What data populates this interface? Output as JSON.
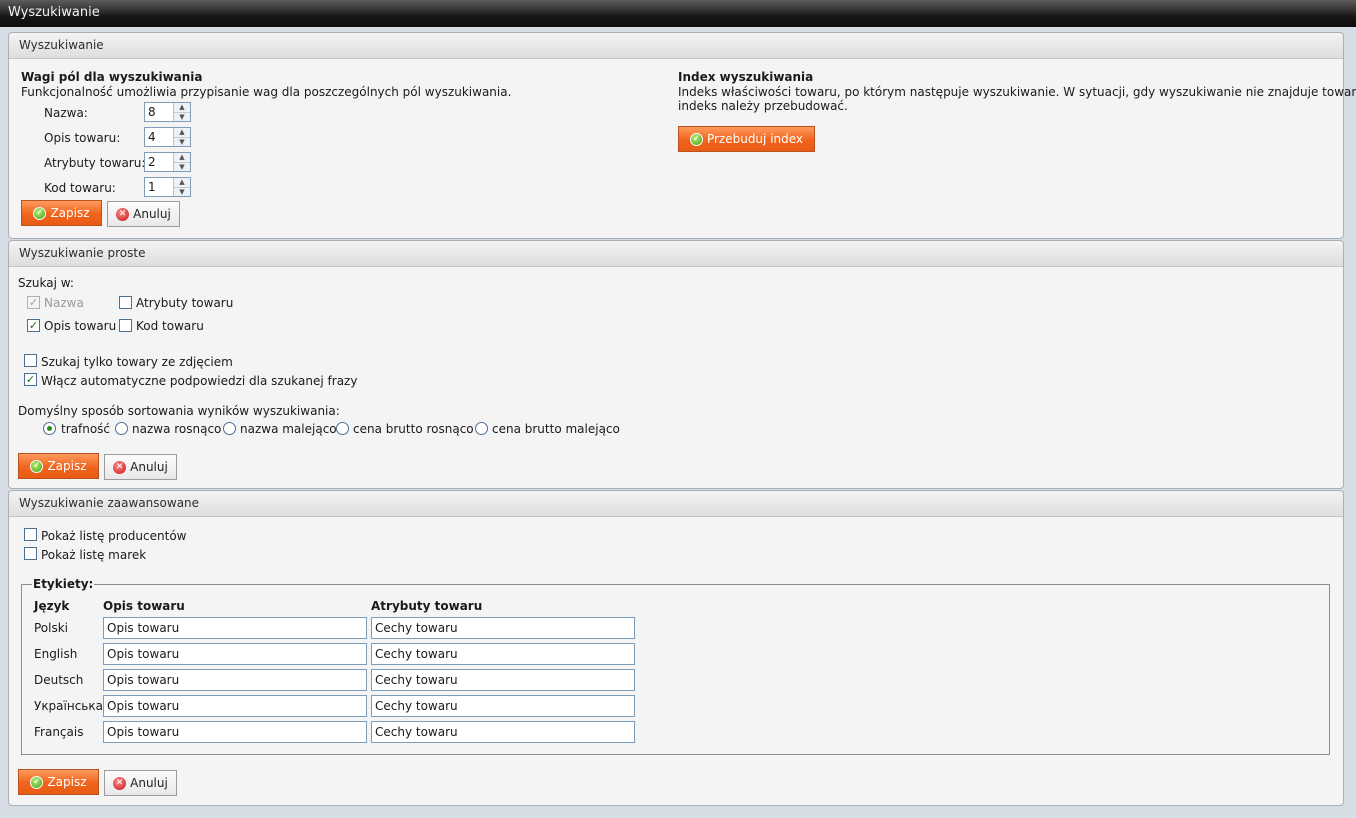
{
  "window": {
    "title": "Wyszukiwanie"
  },
  "icons": {
    "ok": "check-circle-icon",
    "cancel": "x-circle-icon",
    "accent": "#f0641d"
  },
  "section1": {
    "header": "Wyszukiwanie",
    "weights": {
      "title": "Wagi pól dla wyszukiwania",
      "description": "Funkcjonalność umożliwia przypisanie wag dla poszczególnych pól wyszukiwania.",
      "fields": [
        {
          "label": "Nazwa:",
          "value": "8"
        },
        {
          "label": "Opis towaru:",
          "value": "4"
        },
        {
          "label": "Atrybuty towaru:",
          "value": "2"
        },
        {
          "label": "Kod towaru:",
          "value": "1"
        }
      ],
      "save_label": "Zapisz",
      "cancel_label": "Anuluj"
    },
    "index": {
      "title": "Index wyszukiwania",
      "description_line1": "Indeks właściwości towaru, po którym następuje wyszukiwanie. W sytuacji, gdy wyszukiwanie nie znajduje towarów,",
      "description_line2": "indeks należy przebudować.",
      "rebuild_label": "Przebuduj index"
    }
  },
  "section2": {
    "header": "Wyszukiwanie proste",
    "search_in_label": "Szukaj w:",
    "search_in": [
      {
        "label": "Nazwa",
        "checked": true,
        "disabled": true
      },
      {
        "label": "Atrybuty towaru",
        "checked": false,
        "disabled": false
      },
      {
        "label": "Opis towaru",
        "checked": true,
        "disabled": false
      },
      {
        "label": "Kod towaru",
        "checked": false,
        "disabled": false
      }
    ],
    "options": [
      {
        "label": "Szukaj tylko towary ze zdjęciem",
        "checked": false
      },
      {
        "label": "Włącz automatyczne podpowiedzi dla szukanej frazy",
        "checked": true
      }
    ],
    "sort_label": "Domyślny sposób sortowania wyników wyszukiwania:",
    "sort_options": [
      {
        "label": "trafność",
        "selected": true
      },
      {
        "label": "nazwa rosnąco",
        "selected": false
      },
      {
        "label": "nazwa malejąco",
        "selected": false
      },
      {
        "label": "cena brutto rosnąco",
        "selected": false
      },
      {
        "label": "cena brutto malejąco",
        "selected": false
      }
    ],
    "save_label": "Zapisz",
    "cancel_label": "Anuluj"
  },
  "section3": {
    "header": "Wyszukiwanie zaawansowane",
    "options": [
      {
        "label": "Pokaż listę producentów",
        "checked": false
      },
      {
        "label": "Pokaż listę marek",
        "checked": false
      }
    ],
    "labels_legend": "Etykiety:",
    "columns": {
      "lang": "Język",
      "desc": "Opis towaru",
      "attr": "Atrybuty towaru"
    },
    "rows": [
      {
        "lang": "Polski",
        "desc": "Opis towaru",
        "attr": "Cechy towaru"
      },
      {
        "lang": "English",
        "desc": "Opis towaru",
        "attr": "Cechy towaru"
      },
      {
        "lang": "Deutsch",
        "desc": "Opis towaru",
        "attr": "Cechy towaru"
      },
      {
        "lang": "Українська",
        "desc": "Opis towaru",
        "attr": "Cechy towaru"
      },
      {
        "lang": "Français",
        "desc": "Opis towaru",
        "attr": "Cechy towaru"
      }
    ],
    "save_label": "Zapisz",
    "cancel_label": "Anuluj"
  }
}
